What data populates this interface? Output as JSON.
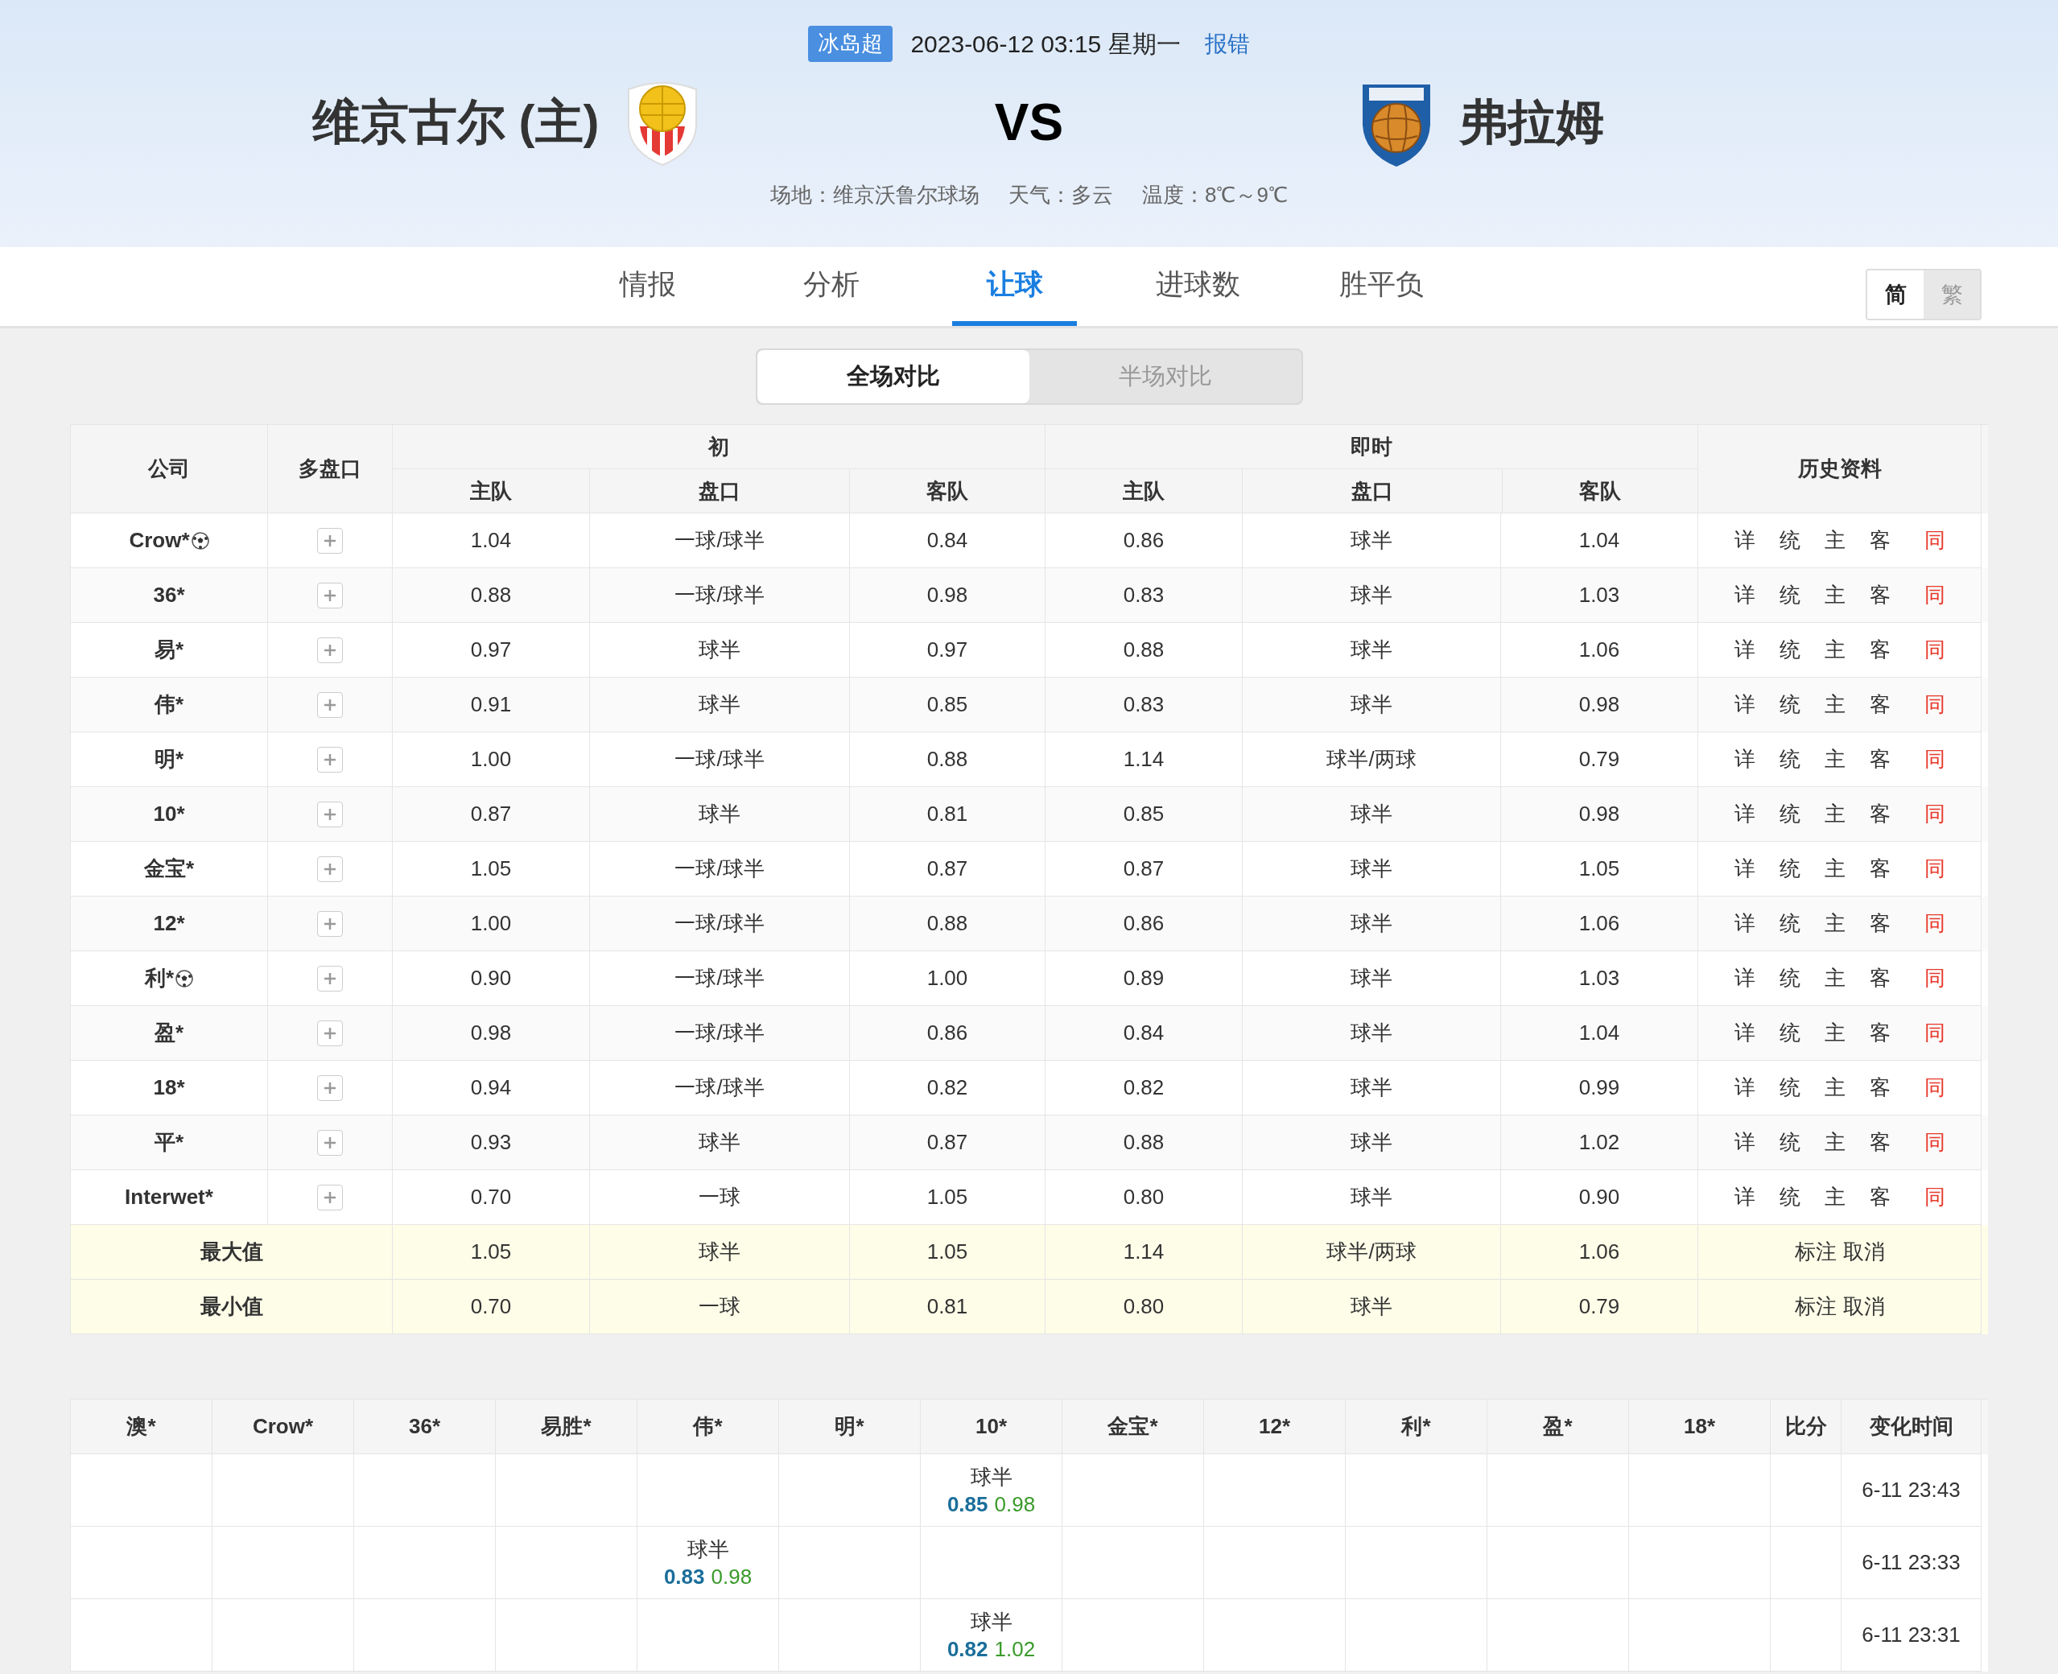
{
  "match": {
    "league": "冰岛超",
    "datetime": "2023-06-12 03:15 星期一",
    "report_link": "报错",
    "home_team": "维京古尔 (主)",
    "vs": "VS",
    "away_team": "弗拉姆",
    "venue": "场地：维京沃鲁尔球场",
    "weather": "天气：多云",
    "temperature": "温度：8℃～9℃"
  },
  "tabs": [
    {
      "label": "情报",
      "selected": false
    },
    {
      "label": "分析",
      "selected": false
    },
    {
      "label": "让球",
      "selected": true
    },
    {
      "label": "进球数",
      "selected": false
    },
    {
      "label": "胜平负",
      "selected": false
    }
  ],
  "language": [
    {
      "label": "简",
      "selected": true
    },
    {
      "label": "繁",
      "selected": false
    }
  ],
  "segments": [
    {
      "label": "全场对比",
      "selected": true
    },
    {
      "label": "半场对比",
      "selected": false
    }
  ],
  "odds_table": {
    "headers": {
      "company": "公司",
      "multi": "多盘口",
      "initial": "初",
      "live": "即时",
      "history": "历史资料",
      "sub": [
        "主队",
        "盘口",
        "客队",
        "主队",
        "盘口",
        "客队"
      ]
    },
    "rows": [
      {
        "company": "Crow*",
        "ball": true,
        "initial": [
          "1.04",
          "一球/球半",
          "0.84"
        ],
        "live": [
          "0.86",
          "球半",
          "1.04"
        ],
        "history": [
          {
            "label": "详",
            "kind": "normal"
          },
          {
            "label": "统",
            "kind": "normal"
          },
          {
            "label": "主",
            "kind": "normal"
          },
          {
            "label": "客",
            "kind": "normal"
          },
          {
            "label": "同",
            "kind": "alert"
          }
        ]
      },
      {
        "company": "36*",
        "ball": false,
        "initial": [
          "0.88",
          "一球/球半",
          "0.98"
        ],
        "live": [
          "0.83",
          "球半",
          "1.03"
        ],
        "history": [
          {
            "label": "详",
            "kind": "normal"
          },
          {
            "label": "统",
            "kind": "normal"
          },
          {
            "label": "主",
            "kind": "normal"
          },
          {
            "label": "客",
            "kind": "normal"
          },
          {
            "label": "同",
            "kind": "alert"
          }
        ]
      },
      {
        "company": "易*",
        "ball": false,
        "initial": [
          "0.97",
          "球半",
          "0.97"
        ],
        "live": [
          "0.88",
          "球半",
          "1.06"
        ],
        "history": [
          {
            "label": "详",
            "kind": "normal"
          },
          {
            "label": "统",
            "kind": "normal"
          },
          {
            "label": "主",
            "kind": "normal"
          },
          {
            "label": "客",
            "kind": "normal"
          },
          {
            "label": "同",
            "kind": "alert"
          }
        ]
      },
      {
        "company": "伟*",
        "ball": false,
        "initial": [
          "0.91",
          "球半",
          "0.85"
        ],
        "live": [
          "0.83",
          "球半",
          "0.98"
        ],
        "history": [
          {
            "label": "详",
            "kind": "normal"
          },
          {
            "label": "统",
            "kind": "normal"
          },
          {
            "label": "主",
            "kind": "normal"
          },
          {
            "label": "客",
            "kind": "normal"
          },
          {
            "label": "同",
            "kind": "alert"
          }
        ]
      },
      {
        "company": "明*",
        "ball": false,
        "initial": [
          "1.00",
          "一球/球半",
          "0.88"
        ],
        "live": [
          "1.14",
          "球半/两球",
          "0.79"
        ],
        "history": [
          {
            "label": "详",
            "kind": "normal"
          },
          {
            "label": "统",
            "kind": "normal"
          },
          {
            "label": "主",
            "kind": "normal"
          },
          {
            "label": "客",
            "kind": "normal"
          },
          {
            "label": "同",
            "kind": "alert"
          }
        ]
      },
      {
        "company": "10*",
        "ball": false,
        "initial": [
          "0.87",
          "球半",
          "0.81"
        ],
        "live": [
          "0.85",
          "球半",
          "0.98"
        ],
        "history": [
          {
            "label": "详",
            "kind": "normal"
          },
          {
            "label": "统",
            "kind": "normal"
          },
          {
            "label": "主",
            "kind": "normal"
          },
          {
            "label": "客",
            "kind": "normal"
          },
          {
            "label": "同",
            "kind": "alert"
          }
        ]
      },
      {
        "company": "金宝*",
        "ball": false,
        "initial": [
          "1.05",
          "一球/球半",
          "0.87"
        ],
        "live": [
          "0.87",
          "球半",
          "1.05"
        ],
        "history": [
          {
            "label": "详",
            "kind": "normal"
          },
          {
            "label": "统",
            "kind": "normal"
          },
          {
            "label": "主",
            "kind": "normal"
          },
          {
            "label": "客",
            "kind": "normal"
          },
          {
            "label": "同",
            "kind": "alert"
          }
        ]
      },
      {
        "company": "12*",
        "ball": false,
        "initial": [
          "1.00",
          "一球/球半",
          "0.88"
        ],
        "live": [
          "0.86",
          "球半",
          "1.06"
        ],
        "history": [
          {
            "label": "详",
            "kind": "normal"
          },
          {
            "label": "统",
            "kind": "normal"
          },
          {
            "label": "主",
            "kind": "normal"
          },
          {
            "label": "客",
            "kind": "normal"
          },
          {
            "label": "同",
            "kind": "alert"
          }
        ]
      },
      {
        "company": "利*",
        "ball": true,
        "initial": [
          "0.90",
          "一球/球半",
          "1.00"
        ],
        "live": [
          "0.89",
          "球半",
          "1.03"
        ],
        "history": [
          {
            "label": "详",
            "kind": "normal"
          },
          {
            "label": "统",
            "kind": "normal"
          },
          {
            "label": "主",
            "kind": "normal"
          },
          {
            "label": "客",
            "kind": "normal"
          },
          {
            "label": "同",
            "kind": "alert"
          }
        ]
      },
      {
        "company": "盈*",
        "ball": false,
        "initial": [
          "0.98",
          "一球/球半",
          "0.86"
        ],
        "live": [
          "0.84",
          "球半",
          "1.04"
        ],
        "history": [
          {
            "label": "详",
            "kind": "normal"
          },
          {
            "label": "统",
            "kind": "normal"
          },
          {
            "label": "主",
            "kind": "normal"
          },
          {
            "label": "客",
            "kind": "normal"
          },
          {
            "label": "同",
            "kind": "alert"
          }
        ]
      },
      {
        "company": "18*",
        "ball": false,
        "initial": [
          "0.94",
          "一球/球半",
          "0.82"
        ],
        "live": [
          "0.82",
          "球半",
          "0.99"
        ],
        "history": [
          {
            "label": "详",
            "kind": "normal"
          },
          {
            "label": "统",
            "kind": "normal"
          },
          {
            "label": "主",
            "kind": "normal"
          },
          {
            "label": "客",
            "kind": "normal"
          },
          {
            "label": "同",
            "kind": "alert"
          }
        ]
      },
      {
        "company": "平*",
        "ball": false,
        "initial": [
          "0.93",
          "球半",
          "0.87"
        ],
        "live": [
          "0.88",
          "球半",
          "1.02"
        ],
        "history": [
          {
            "label": "详",
            "kind": "normal"
          },
          {
            "label": "统",
            "kind": "normal"
          },
          {
            "label": "主",
            "kind": "normal"
          },
          {
            "label": "客",
            "kind": "normal"
          },
          {
            "label": "同",
            "kind": "alert"
          }
        ]
      },
      {
        "company": "Interwet*",
        "ball": false,
        "initial": [
          "0.70",
          "一球",
          "1.05"
        ],
        "live": [
          "0.80",
          "球半",
          "0.90"
        ],
        "history": [
          {
            "label": "详",
            "kind": "normal"
          },
          {
            "label": "统",
            "kind": "normal"
          },
          {
            "label": "主",
            "kind": "normal"
          },
          {
            "label": "客",
            "kind": "normal"
          },
          {
            "label": "同",
            "kind": "alert"
          }
        ]
      }
    ],
    "summary": [
      {
        "label": "最大值",
        "values": [
          "1.05",
          "球半",
          "1.05",
          "1.14",
          "球半/两球",
          "1.06"
        ],
        "actions": [
          "标注",
          "取消"
        ]
      },
      {
        "label": "最小值",
        "values": [
          "0.70",
          "一球",
          "0.81",
          "0.80",
          "球半",
          "0.79"
        ],
        "actions": [
          "标注",
          "取消"
        ]
      }
    ]
  },
  "change_table": {
    "columns": [
      "澳*",
      "Crow*",
      "36*",
      "易胜*",
      "伟*",
      "明*",
      "10*",
      "金宝*",
      "12*",
      "利*",
      "盈*",
      "18*",
      "比分",
      "变化时间"
    ],
    "rows": [
      {
        "cells": [
          {},
          {},
          {},
          {},
          {},
          {},
          {
            "line": "球半",
            "home": "0.85",
            "away": "0.98"
          },
          {},
          {},
          {},
          {},
          {},
          {}
        ],
        "time": "6-11 23:43"
      },
      {
        "cells": [
          {},
          {},
          {},
          {},
          {
            "line": "球半",
            "home": "0.83",
            "away": "0.98"
          },
          {},
          {},
          {},
          {},
          {},
          {},
          {},
          {}
        ],
        "time": "6-11 23:33"
      },
      {
        "cells": [
          {},
          {},
          {},
          {},
          {},
          {},
          {
            "line": "球半",
            "home": "0.82",
            "away": "1.02"
          },
          {},
          {},
          {},
          {},
          {},
          {}
        ],
        "time": "6-11 23:31"
      }
    ]
  }
}
